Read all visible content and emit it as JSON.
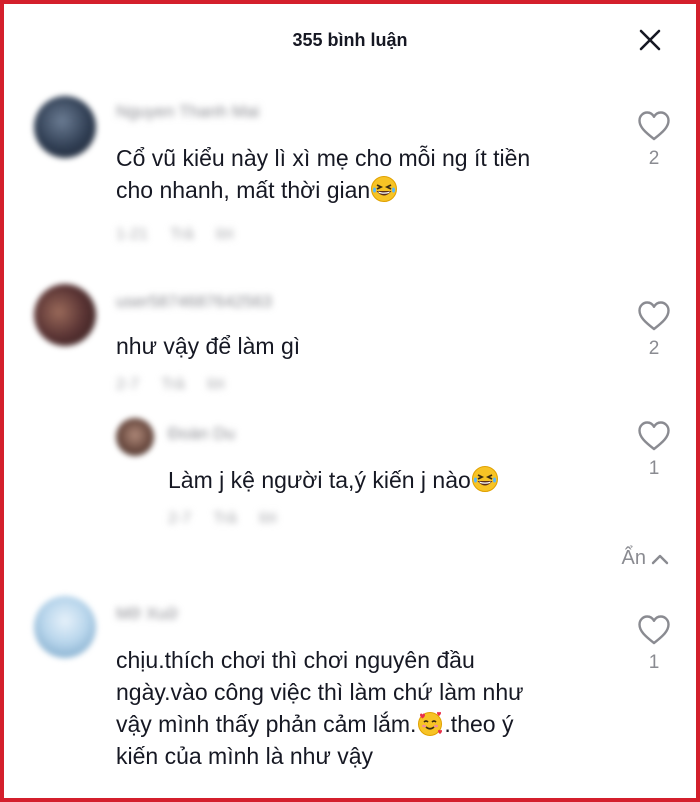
{
  "header": {
    "title": "355 bình luận",
    "close_icon": "close-icon"
  },
  "comments": [
    {
      "username": "Nguyen Thanh Mai",
      "text_line1": "Cổ vũ kiểu này lì xì mẹ cho mỗi ng ít tiền",
      "text_line2": "cho nhanh, mất thời gian",
      "meta": "1-21 Trả lời",
      "likes": "2"
    },
    {
      "username": "user5874687642563",
      "text": "như vậy để làm gì",
      "meta": "2-7 Trả lời",
      "likes": "2",
      "reply": {
        "username": "Đoàn Du",
        "text": "Làm j kệ người ta,ý kiến j nào",
        "meta": "2-7 Trả lời",
        "likes": "1"
      }
    },
    {
      "username": "Mỡ Xuữ",
      "text_line1": "chịu.thích chơi thì chơi nguyên đầu",
      "text_line2": "ngày.vào công việc thì làm chứ làm như",
      "text_line3_a": "vậy mình thấy phản cảm lắm.",
      "text_line3_b": ".theo ý",
      "text_line4": "kiến của mình là như vậy",
      "likes": "1"
    }
  ],
  "hide_replies": {
    "label": "Ẩn"
  },
  "colors": {
    "accent_border": "#d41f2c",
    "muted": "#8a8b91",
    "text": "#161823"
  }
}
